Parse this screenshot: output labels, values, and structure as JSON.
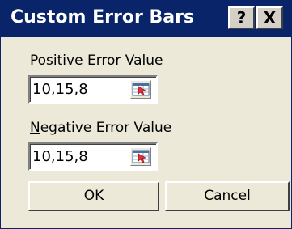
{
  "window": {
    "title": "Custom Error Bars",
    "help_label": "?",
    "close_label": "X"
  },
  "positive": {
    "label_accel": "P",
    "label_rest": "ositive Error Value",
    "value": "10,15,8",
    "ref_icon": "collapse-dialog-icon"
  },
  "negative": {
    "label_accel": "N",
    "label_rest": "egative Error Value",
    "value": "10,15,8",
    "ref_icon": "collapse-dialog-icon"
  },
  "buttons": {
    "ok_label": "OK",
    "cancel_label": "Cancel"
  },
  "colors": {
    "titlebar": "#0a246a",
    "dialog_bg": "#ece9d8",
    "ref_icon_red": "#e0303a"
  }
}
